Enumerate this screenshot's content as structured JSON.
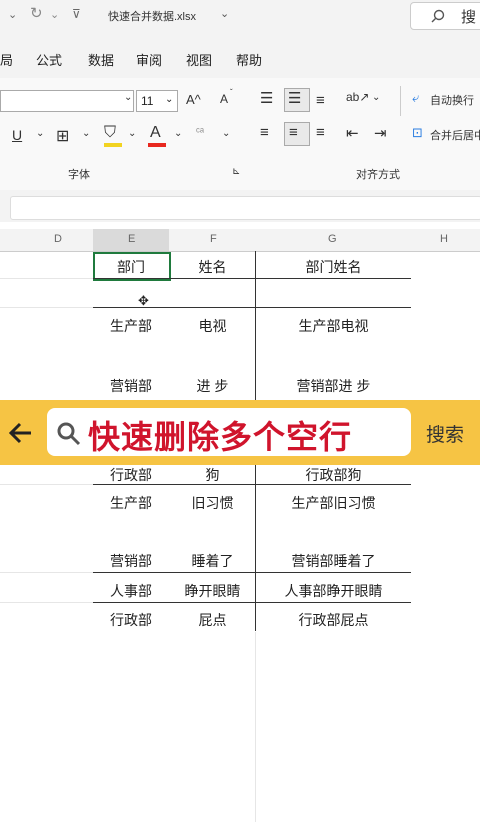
{
  "titlebar": {
    "filename": "快速合并数据.xlsx",
    "search_label": "搜"
  },
  "menu": {
    "items": [
      "局",
      "公式",
      "数据",
      "审阅",
      "视图",
      "帮助"
    ]
  },
  "ribbon": {
    "font_size": "11",
    "grow_font": "A^",
    "shrink_font": "A",
    "font_color_letter": "A",
    "group_font": "字体",
    "group_launcher": "⊾",
    "group_alignment": "对齐方式",
    "wrap_text": "自动换行",
    "merge_center": "合并后居中"
  },
  "columns": [
    "D",
    "E",
    "F",
    "G",
    "H"
  ],
  "table": {
    "headers": {
      "dept": "部门",
      "name": "姓名",
      "combined": "部门姓名"
    },
    "rows": [
      {
        "dept": "生产部",
        "name": "电视",
        "combined": "生产部电视"
      },
      {
        "dept": "营销部",
        "name": "进 步",
        "combined": "营销部进 步"
      },
      {
        "dept": "行政部",
        "name": "狗",
        "combined": "行政部狗"
      },
      {
        "dept": "生产部",
        "name": "旧习惯",
        "combined": "生产部旧习惯"
      },
      {
        "dept": "营销部",
        "name": "睡着了",
        "combined": "营销部睡着了"
      },
      {
        "dept": "人事部",
        "name": "睁开眼睛",
        "combined": "人事部睁开眼睛"
      },
      {
        "dept": "行政部",
        "name": "屁点",
        "combined": "行政部屁点"
      }
    ]
  },
  "banner": {
    "query": "快速删除多个空行",
    "action": "搜索",
    "color": "#f6c444",
    "query_color": "#d0142c"
  },
  "icons": [
    "back-arrow-icon",
    "search-icon",
    "undo-icon",
    "redo-icon",
    "customize-icon",
    "cursor-move-icon"
  ]
}
